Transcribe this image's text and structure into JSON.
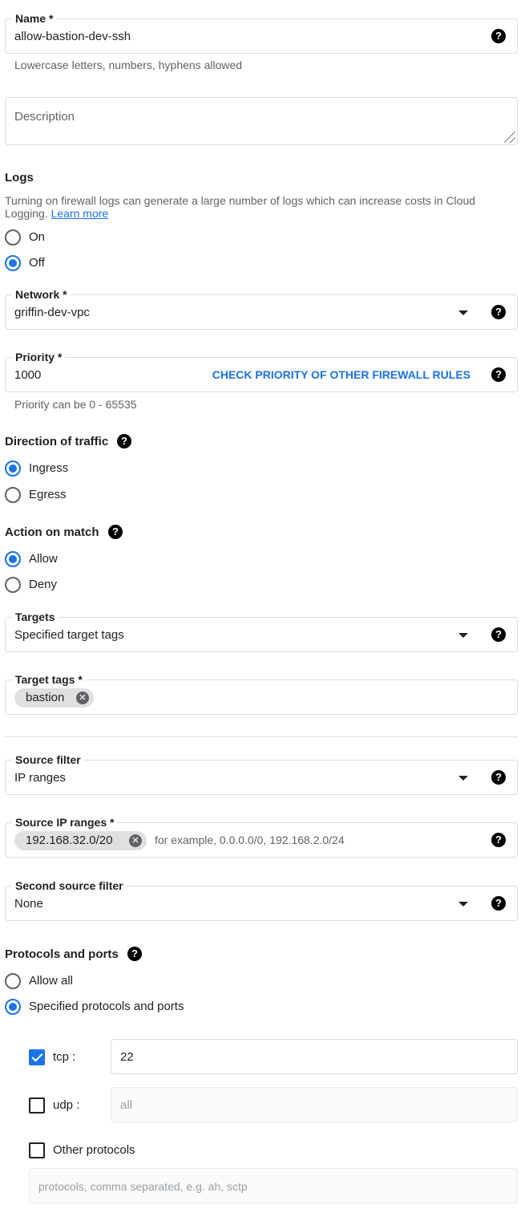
{
  "name": {
    "label": "Name *",
    "value": "allow-bastion-dev-ssh",
    "hint": "Lowercase letters, numbers, hyphens allowed"
  },
  "description": {
    "placeholder": "Description"
  },
  "logs": {
    "title": "Logs",
    "text": "Turning on firewall logs can generate a large number of logs which can increase costs in Cloud",
    "text2": "Logging.",
    "learn_more": "Learn more",
    "options": [
      "On",
      "Off"
    ],
    "selected": "Off"
  },
  "network": {
    "label": "Network *",
    "value": "griffin-dev-vpc"
  },
  "priority": {
    "label": "Priority *",
    "value": "1000",
    "link": "CHECK PRIORITY OF OTHER FIREWALL RULES",
    "hint": "Priority can be 0 - 65535"
  },
  "direction": {
    "title": "Direction of traffic",
    "options": [
      "Ingress",
      "Egress"
    ],
    "selected": "Ingress"
  },
  "action": {
    "title": "Action on match",
    "options": [
      "Allow",
      "Deny"
    ],
    "selected": "Allow"
  },
  "targets": {
    "label": "Targets",
    "value": "Specified target tags"
  },
  "target_tags": {
    "label": "Target tags *",
    "chips": [
      "bastion"
    ]
  },
  "source_filter": {
    "label": "Source filter",
    "value": "IP ranges"
  },
  "source_ip": {
    "label": "Source IP ranges *",
    "chips": [
      "192.168.32.0/20"
    ],
    "placeholder": "for example, 0.0.0.0/0, 192.168.2.0/24"
  },
  "second_source_filter": {
    "label": "Second source filter",
    "value": "None"
  },
  "protocols": {
    "title": "Protocols and ports",
    "options": [
      "Allow all",
      "Specified protocols and ports"
    ],
    "selected": "Specified protocols and ports",
    "tcp": {
      "label": "tcp :",
      "checked": true,
      "value": "22"
    },
    "udp": {
      "label": "udp :",
      "checked": false,
      "placeholder": "all"
    },
    "other": {
      "label": "Other protocols",
      "checked": false,
      "placeholder": "protocols, comma separated, e.g. ah, sctp"
    }
  },
  "icons": {
    "help": "help-icon",
    "dropdown": "dropdown-caret-icon",
    "chip_remove": "chip-remove-icon"
  },
  "colors": {
    "accent": "#1a73e8",
    "border": "#dadce0",
    "hint": "#5f6368"
  }
}
